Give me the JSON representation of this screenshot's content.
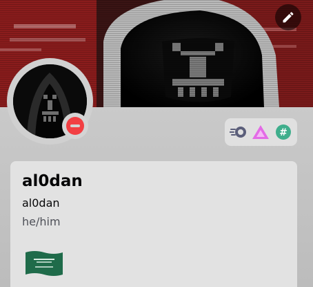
{
  "profile": {
    "display_name": "al0dan",
    "username": "al0dan",
    "pronouns": "he/him",
    "status": "do-not-disturb",
    "status_color": "#f23f43",
    "banner_icon": "pencil-icon",
    "badges": [
      {
        "icon": "nitro-badge-icon",
        "color": "#5b5e7a"
      },
      {
        "icon": "hypesquad-badge-icon",
        "color": "#d35bd8"
      },
      {
        "icon": "hashtag-badge-icon",
        "color": "#3fae8c"
      }
    ],
    "flag_icon": "saudi-flag-icon"
  }
}
